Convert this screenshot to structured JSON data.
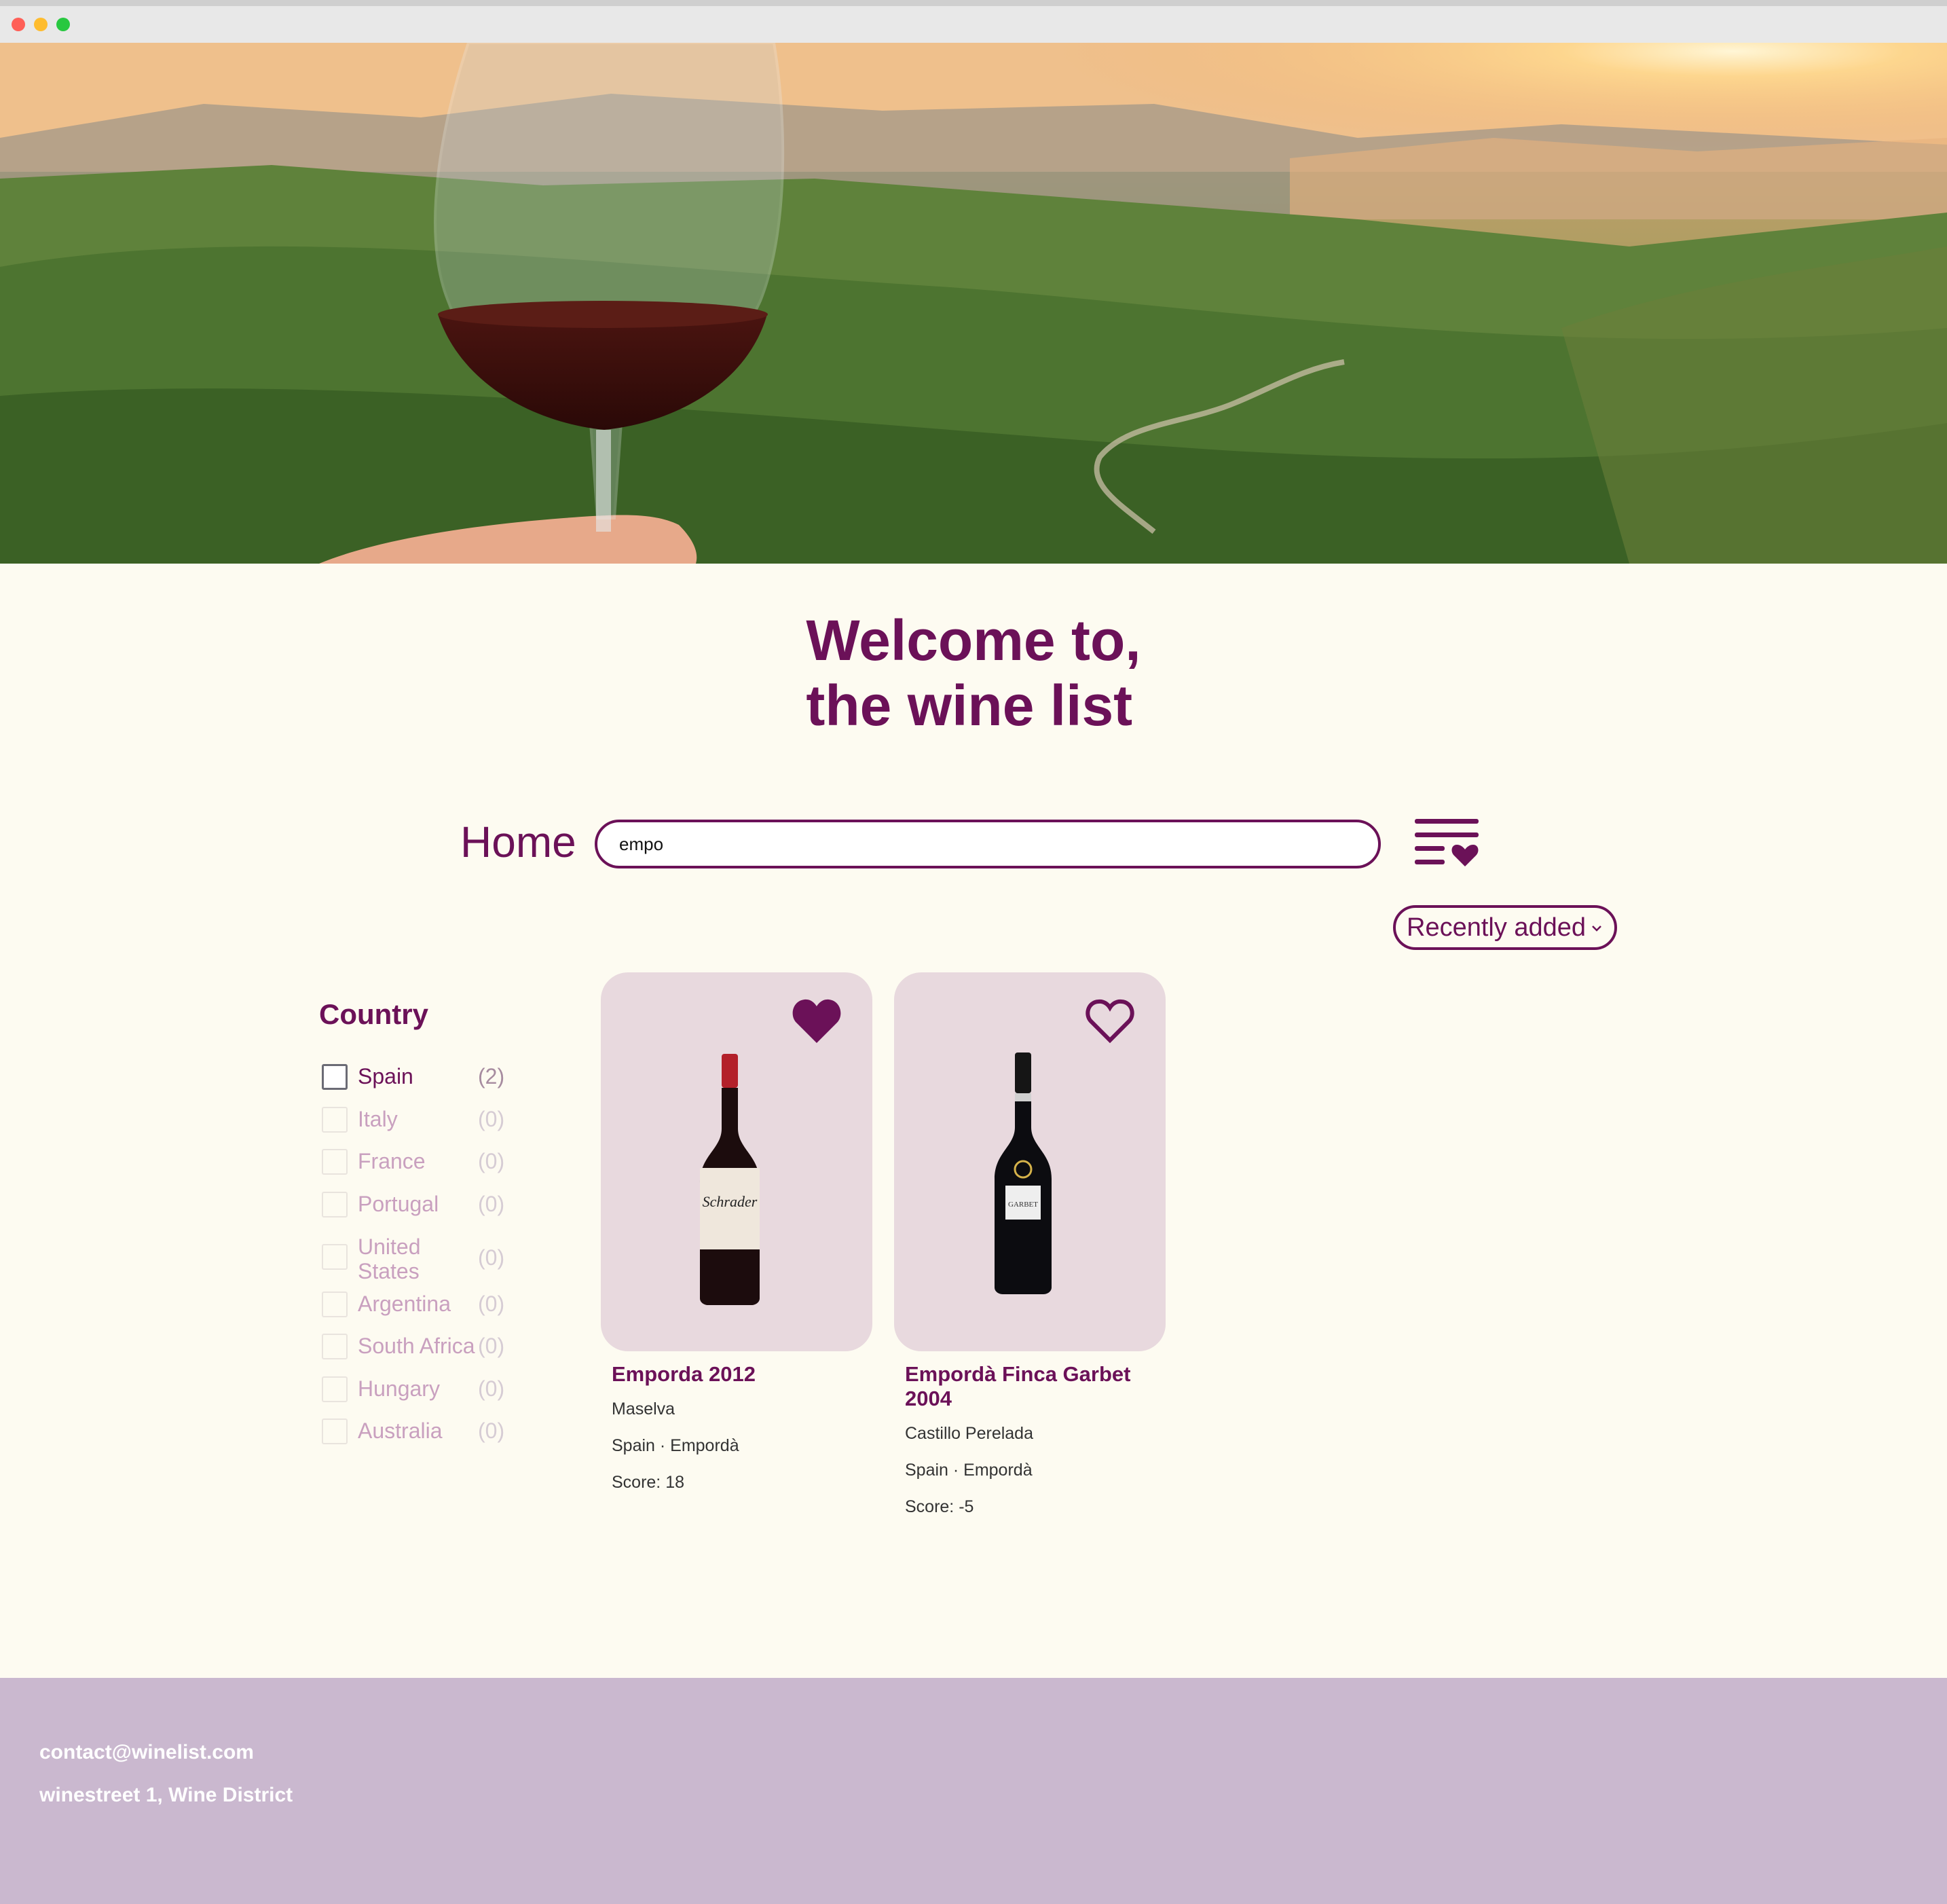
{
  "header": {
    "title_line1": "Welcome to,",
    "title_line2": "the wine list"
  },
  "nav": {
    "home_label": "Home",
    "search_value": "empo",
    "favorites_icon": "list-heart-icon"
  },
  "sort": {
    "selected": "Recently added"
  },
  "filters": {
    "title": "Country",
    "items": [
      {
        "name": "Spain",
        "count": "(2)",
        "enabled": true
      },
      {
        "name": "Italy",
        "count": "(0)",
        "enabled": false
      },
      {
        "name": "France",
        "count": "(0)",
        "enabled": false
      },
      {
        "name": "Portugal",
        "count": "(0)",
        "enabled": false
      },
      {
        "name": "United States",
        "count": "(0)",
        "enabled": false
      },
      {
        "name": "Argentina",
        "count": "(0)",
        "enabled": false
      },
      {
        "name": "South Africa",
        "count": "(0)",
        "enabled": false
      },
      {
        "name": "Hungary",
        "count": "(0)",
        "enabled": false
      },
      {
        "name": "Australia",
        "count": "(0)",
        "enabled": false
      }
    ]
  },
  "wines": [
    {
      "name": "Emporda 2012",
      "producer": "Maselva",
      "origin": "Spain · Empordà",
      "score": "Score: 18",
      "favorited": true,
      "bottle_label": "Schrader"
    },
    {
      "name": "Empordà Finca Garbet 2004",
      "producer": "Castillo Perelada",
      "origin": "Spain · Empordà",
      "score": "Score: -5",
      "favorited": false,
      "bottle_label": "GARBET"
    }
  ],
  "footer": {
    "email": "contact@winelist.com",
    "address": "winestreet 1, Wine District"
  },
  "colors": {
    "brand": "#6b1158",
    "background": "#fdfbf1",
    "card": "#e8d9de",
    "footer": "#cab8cf"
  }
}
